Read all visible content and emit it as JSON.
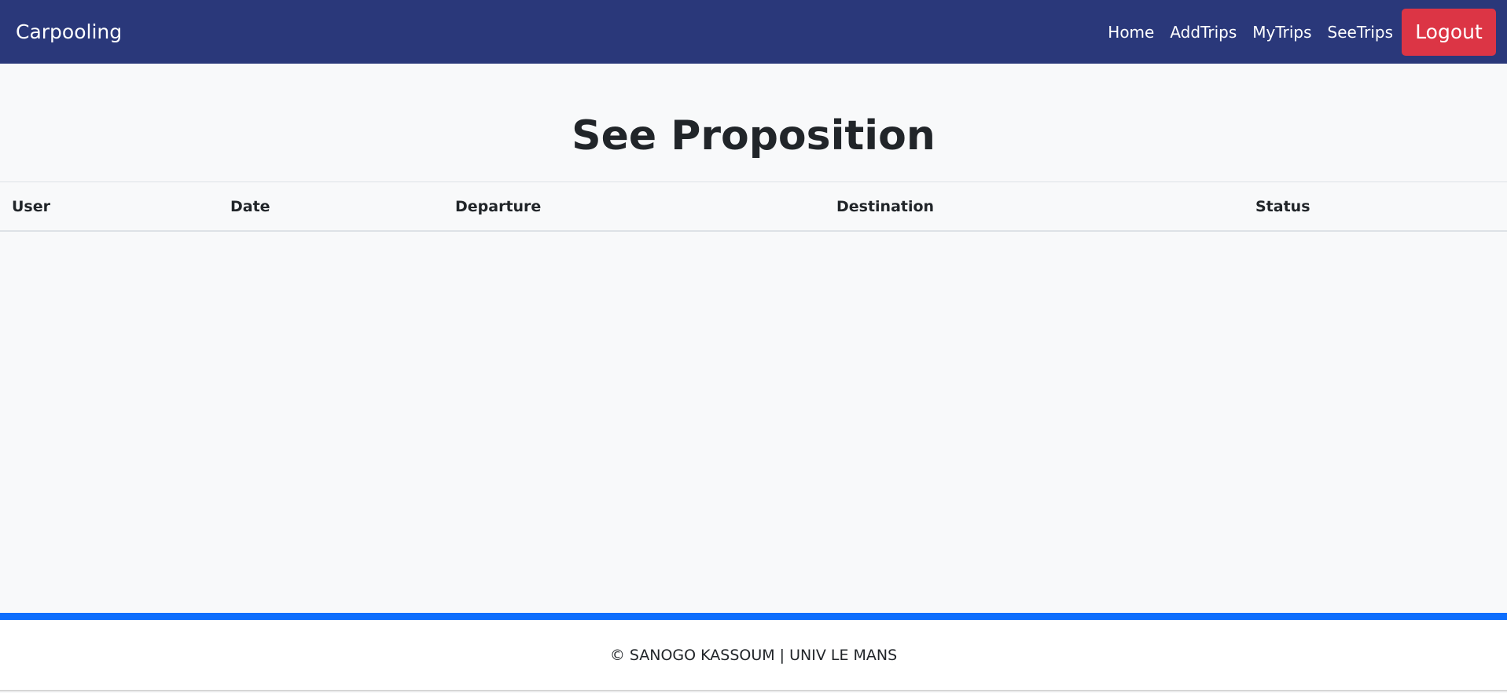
{
  "navbar": {
    "brand": "Carpooling",
    "links": [
      "Home",
      "AddTrips",
      "MyTrips",
      "SeeTrips"
    ],
    "logout_label": "Logout"
  },
  "main": {
    "title": "See Proposition",
    "table": {
      "columns": [
        "User",
        "Date",
        "Departure",
        "Destination",
        "Status"
      ],
      "rows": []
    }
  },
  "footer": {
    "text": "© SANOGO KASSOUM | UNIV LE MANS"
  },
  "colors": {
    "navbar_bg": "#2a387a",
    "logout_bg": "#dc3545",
    "footer_accent": "#0d6efd",
    "page_bg": "#f8f9fa"
  }
}
